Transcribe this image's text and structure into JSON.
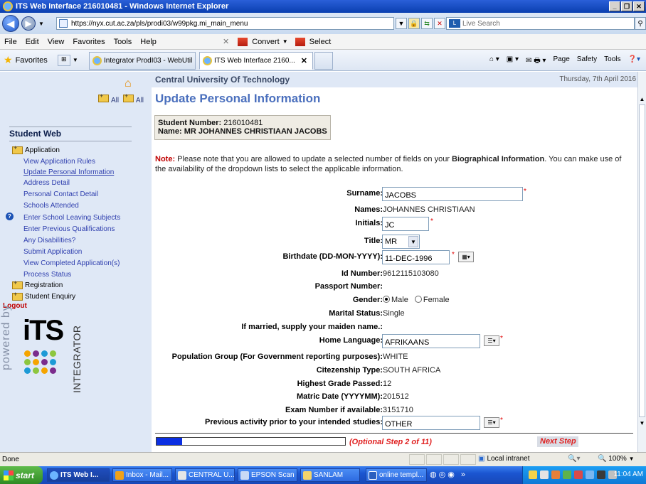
{
  "window": {
    "title": "ITS Web Interface 216010481 - Windows Internet Explorer"
  },
  "addressbar": {
    "url": "https://nyx.cut.ac.za/pls/prodi03/w99pkg.mi_main_menu",
    "search_placeholder": "Live Search"
  },
  "menubar": {
    "items": [
      "File",
      "Edit",
      "View",
      "Favorites",
      "Tools",
      "Help"
    ],
    "convert": "Convert",
    "select": "Select"
  },
  "favbar": {
    "favorites": "Favorites",
    "tabs": [
      "Integrator ProdI03 - WebUtil",
      "ITS Web Interface 2160..."
    ],
    "tools": [
      "Page",
      "Safety",
      "Tools"
    ]
  },
  "sidebar": {
    "expand_label": "All",
    "collapse_label": "All",
    "title": "Student Web",
    "sections": {
      "application": "Application",
      "registration": "Registration",
      "enquiry": "Student Enquiry"
    },
    "links": [
      "View Application Rules",
      "Update Personal Information",
      "Address Detail",
      "Personal Contact Detail",
      "Schools Attended",
      "Enter School Leaving Subjects",
      "Enter Previous Qualifications",
      "Any Disabilities?",
      "Submit Application",
      "View Completed Application(s)",
      "Process Status"
    ],
    "logout": "Logout",
    "powered_by": "powered by",
    "logo_main": "iTS",
    "logo_sub": "INTEGRATOR"
  },
  "main": {
    "institution": "Central University Of Technology",
    "date": "Thursday, 7th April 2016",
    "page_title": "Update Personal Information",
    "student_number_label": "Student Number:",
    "student_number": "216010481",
    "name_label": "Name:",
    "name": "MR JOHANNES CHRISTIAAN JACOBS",
    "note_label": "Note:",
    "note_text_1": " Please note that you are allowed to update a selected number of fields on your ",
    "note_bold": "Biographical Information",
    "note_text_2": ". You can make use of the availability of the dropdown lists to select the applicable information."
  },
  "form": {
    "surname_label": "Surname:",
    "surname": "JACOBS",
    "names_label": "Names:",
    "names": "JOHANNES CHRISTIAAN",
    "initials_label": "Initials:",
    "initials": "JC",
    "title_label": "Title:",
    "title": "MR",
    "birthdate_label": "Birthdate (DD-MON-YYYY):",
    "birthdate": "11-DEC-1996",
    "id_label": "Id Number:",
    "id_number": "9612115103080",
    "passport_label": "Passport Number:",
    "passport": "",
    "gender_label": "Gender:",
    "gender_options": [
      "Male",
      "Female"
    ],
    "gender_selected": "Male",
    "marital_label": "Marital Status:",
    "marital": "Single",
    "maiden_label": "If married, supply your maiden name.:",
    "maiden": "",
    "language_label": "Home Language:",
    "language": "AFRIKAANS",
    "population_label": "Population Group (For Government reporting purposes):",
    "population": "WHITE",
    "citizenship_label": "Citezenship Type:",
    "citizenship": "SOUTH AFRICA",
    "grade_label": "Highest Grade Passed:",
    "grade": "12",
    "matric_label": "Matric Date (YYYYMM):",
    "matric": "201512",
    "exam_label": "Exam Number if available:",
    "exam": "3151710",
    "activity_label": "Previous activity prior to your intended studies:",
    "activity": "OTHER"
  },
  "progress": {
    "fraction": 0.136,
    "step_text": "(Optional Step 2 of 11)",
    "next_label": "Next Step"
  },
  "statusbar": {
    "status": "Done",
    "zone": "Local intranet",
    "zoom": "100%"
  },
  "taskbar": {
    "start": "start",
    "tasks": [
      "ITS Web I...",
      "Inbox - Mail...",
      "CENTRAL U...",
      "EPSON Scan",
      "SANLAM",
      "online templ..."
    ],
    "clock": "11:04 AM"
  }
}
